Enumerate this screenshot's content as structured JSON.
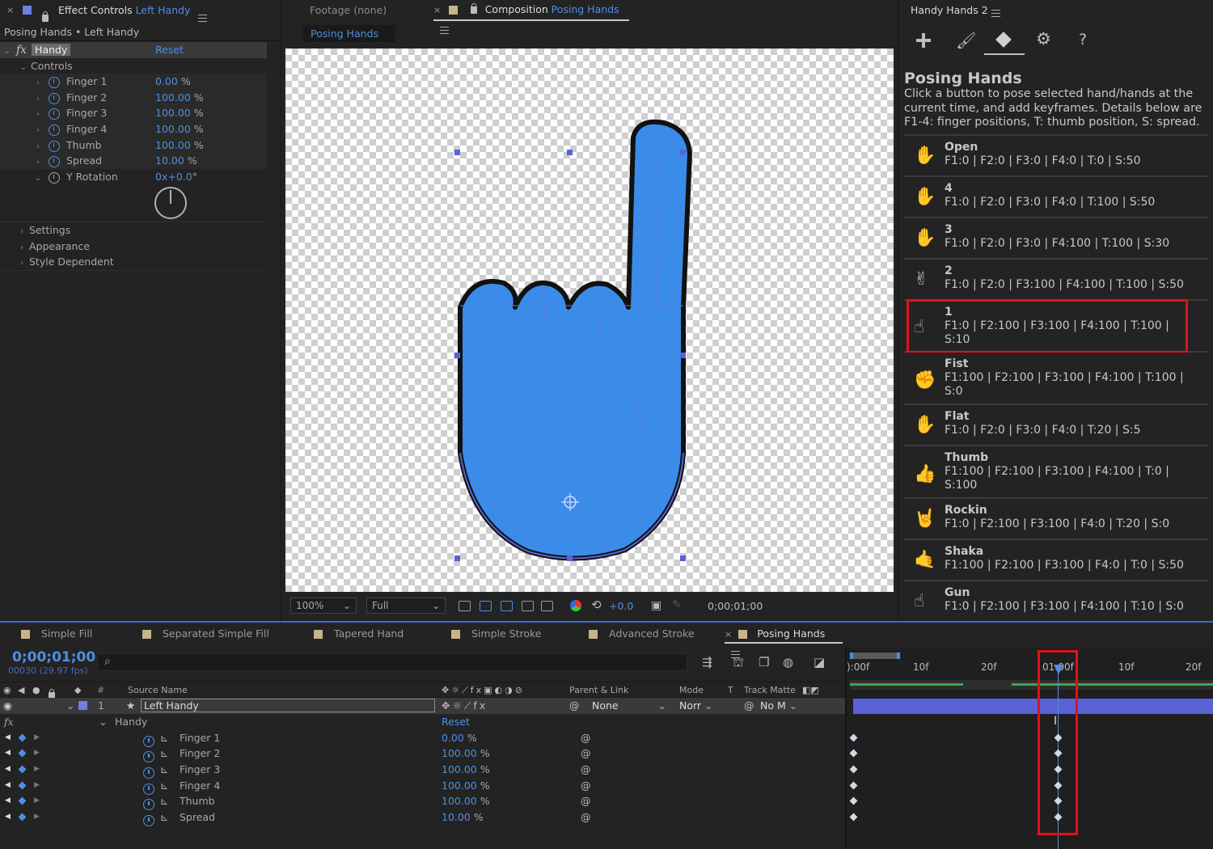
{
  "effect_controls": {
    "tab_title": "Effect Controls",
    "tab_layer": "Left Handy",
    "breadcrumb": "Posing Hands • Left Handy",
    "effect_name": "Handy",
    "reset": "Reset",
    "controls_label": "Controls",
    "props": [
      {
        "name": "Finger 1",
        "value": "0.00",
        "unit": "%"
      },
      {
        "name": "Finger 2",
        "value": "100.00",
        "unit": "%"
      },
      {
        "name": "Finger 3",
        "value": "100.00",
        "unit": "%"
      },
      {
        "name": "Finger 4",
        "value": "100.00",
        "unit": "%"
      },
      {
        "name": "Thumb",
        "value": "100.00",
        "unit": "%"
      },
      {
        "name": "Spread",
        "value": "10.00",
        "unit": "%"
      },
      {
        "name": "Y Rotation",
        "value": "0x+0.0",
        "unit": "°"
      }
    ],
    "groups": [
      "Settings",
      "Appearance",
      "Style Dependent"
    ]
  },
  "composition": {
    "footage_tab": "Footage  (none)",
    "comp_tab_prefix": "Composition",
    "comp_tab_name": "Posing Hands",
    "sub_tab": "Posing Hands",
    "zoom": "100%",
    "resolution": "Full",
    "exposure": "+0.0",
    "timecode": "0;00;01;00"
  },
  "handy_panel": {
    "title": "Handy Hands 2",
    "heading": "Posing Hands",
    "description": "Click a button to pose selected hand/hands at the current time, and add keyframes. Details below are F1-4: finger positions, T: thumb position, S: spread.",
    "poses": [
      {
        "name": "Open",
        "desc": "F1:0 | F2:0 | F3:0 | F4:0 | T:0 | S:50"
      },
      {
        "name": "4",
        "desc": "F1:0 | F2:0 | F3:0 | F4:0 | T:100 | S:50"
      },
      {
        "name": "3",
        "desc": "F1:0 | F2:0 | F3:0 | F4:100 | T:100 | S:30"
      },
      {
        "name": "2",
        "desc": "F1:0 | F2:0 | F3:100 | F4:100 | T:100 | S:50"
      },
      {
        "name": "1",
        "desc": "F1:0 | F2:100 | F3:100 | F4:100 | T:100 | S:10"
      },
      {
        "name": "Fist",
        "desc": "F1:100 | F2:100 | F3:100 | F4:100 | T:100 | S:0"
      },
      {
        "name": "Flat",
        "desc": "F1:0 | F2:0 | F3:0 | F4:0 | T:20 | S:5"
      },
      {
        "name": "Thumb",
        "desc": "F1:100 | F2:100 | F3:100 | F4:100 | T:0 | S:100"
      },
      {
        "name": "Rockin",
        "desc": "F1:0 | F2:100 | F3:100 | F4:0 | T:20 | S:0"
      },
      {
        "name": "Shaka",
        "desc": "F1:100 | F2:100 | F3:100 | F4:0 | T:0 | S:50"
      },
      {
        "name": "Gun",
        "desc": "F1:0 | F2:100 | F3:100 | F4:100 | T:10 | S:0"
      }
    ]
  },
  "timeline": {
    "tabs": [
      "Simple Fill",
      "Separated Simple Fill",
      "Tapered Hand",
      "Simple Stroke",
      "Advanced Stroke",
      "Posing Hands"
    ],
    "timecode": "0;00;01;00",
    "frame_info": "00030 (29.97 fps)",
    "columns": {
      "source_name": "Source Name",
      "parent": "Parent & Link",
      "mode": "Mode",
      "t": "T",
      "track_matte": "Track Matte"
    },
    "layer": {
      "index": "1",
      "name": "Left Handy",
      "parent": "None",
      "mode": "Norr",
      "matte": "No M"
    },
    "effect": {
      "name": "Handy",
      "reset": "Reset"
    },
    "props": [
      {
        "name": "Finger 1",
        "value": "0.00",
        "unit": "%"
      },
      {
        "name": "Finger 2",
        "value": "100.00",
        "unit": "%"
      },
      {
        "name": "Finger 3",
        "value": "100.00",
        "unit": "%"
      },
      {
        "name": "Finger 4",
        "value": "100.00",
        "unit": "%"
      },
      {
        "name": "Thumb",
        "value": "100.00",
        "unit": "%"
      },
      {
        "name": "Spread",
        "value": "10.00",
        "unit": "%"
      }
    ],
    "ruler": [
      "):00f",
      "10f",
      "20f",
      "01:00f",
      "10f",
      "20f"
    ]
  },
  "colors": {
    "accent": "#4f8fe0",
    "hand_fill": "#3b8ce8",
    "highlight_box": "#e0121b",
    "layer_bar": "#5a62d6",
    "label_swatch": "#c8b48a"
  }
}
